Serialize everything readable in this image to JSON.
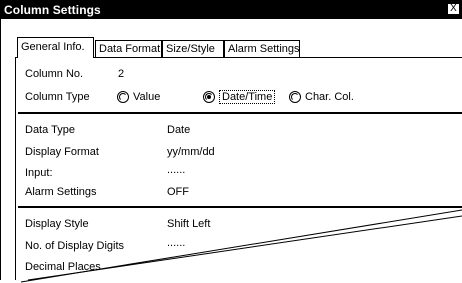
{
  "window": {
    "title": "Column Settings",
    "close_label": "X"
  },
  "tabs": [
    {
      "label": "General Info."
    },
    {
      "label": "Data Format"
    },
    {
      "label": "Size/Style"
    },
    {
      "label": "Alarm Settings"
    }
  ],
  "column": {
    "no_label": "Column No.",
    "no_value": "2",
    "type_label": "Column Type",
    "type_options": [
      {
        "label": "Value",
        "selected": false
      },
      {
        "label": "Date/Time",
        "selected": true
      },
      {
        "label": "Char. Col.",
        "selected": false
      }
    ]
  },
  "data_section": [
    {
      "label": "Data Type",
      "value": "Date"
    },
    {
      "label": "Display Format",
      "value": "yy/mm/dd"
    },
    {
      "label": "Input:",
      "value": "......"
    },
    {
      "label": "Alarm Settings",
      "value": "OFF"
    }
  ],
  "display_section": [
    {
      "label": "Display Style",
      "value": "Shift Left"
    },
    {
      "label": "No. of Display Digits",
      "value": "......"
    },
    {
      "label": "Decimal Places",
      "value": ""
    }
  ]
}
